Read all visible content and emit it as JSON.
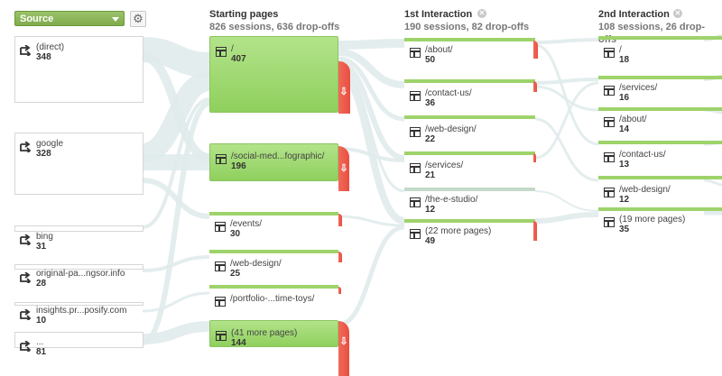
{
  "toolbar": {
    "source_dimension": "Source",
    "settings_icon": "gear-icon"
  },
  "columns": [
    {
      "title": "Starting pages",
      "summary": "826 sessions, 636 drop-offs"
    },
    {
      "title": "1st Interaction",
      "summary": "190 sessions, 82 drop-offs"
    },
    {
      "title": "2nd Interaction",
      "summary": "108 sessions, 26 drop-offs"
    }
  ],
  "sources": [
    {
      "label": "(direct)",
      "count": "348"
    },
    {
      "label": "google",
      "count": "328"
    },
    {
      "label": "bing",
      "count": "31"
    },
    {
      "label": "original-pa...ngsor.info",
      "count": "28"
    },
    {
      "label": "insights.pr...posify.com",
      "count": "10"
    },
    {
      "label": "...",
      "count": "81"
    }
  ],
  "starting_pages": [
    {
      "page": "/",
      "count": "407"
    },
    {
      "page": "/social-med...fographic/",
      "count": "196"
    },
    {
      "page": "/events/",
      "count": "30"
    },
    {
      "page": "/web-design/",
      "count": "25"
    },
    {
      "page": "/portfolio-...time-toys/",
      "count": ""
    },
    {
      "page": "(41 more pages)",
      "count": "144"
    }
  ],
  "first_interaction": [
    {
      "page": "/about/",
      "count": "50"
    },
    {
      "page": "/contact-us/",
      "count": "36"
    },
    {
      "page": "/web-design/",
      "count": "22"
    },
    {
      "page": "/services/",
      "count": "21"
    },
    {
      "page": "/the-e-studio/",
      "count": "12"
    },
    {
      "page": "(22 more pages)",
      "count": "49"
    }
  ],
  "second_interaction": [
    {
      "page": "/",
      "count": "18"
    },
    {
      "page": "/services/",
      "count": "16"
    },
    {
      "page": "/about/",
      "count": "14"
    },
    {
      "page": "/contact-us/",
      "count": "13"
    },
    {
      "page": "/web-design/",
      "count": "12"
    },
    {
      "page": "(19 more pages)",
      "count": "35"
    }
  ],
  "colors": {
    "node_green": "#9ed36b",
    "drop_red": "#e94f3f",
    "flow": "#dde9ea"
  }
}
